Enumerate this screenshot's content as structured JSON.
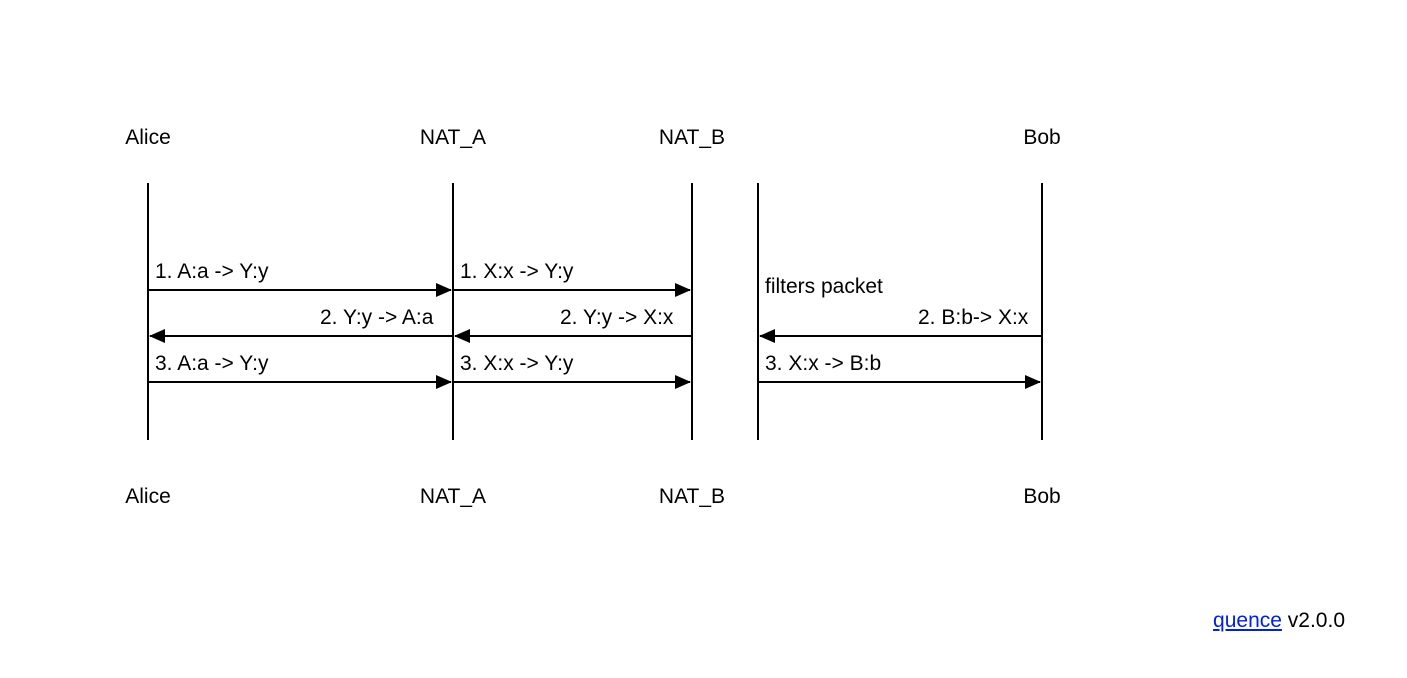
{
  "actors": {
    "alice": "Alice",
    "nat_a": "NAT_A",
    "nat_b": "NAT_B",
    "bob": "Bob"
  },
  "messages": {
    "r1_ab": "1. A:a -> Y:y",
    "r1_bc": "1. X:x -> Y:y",
    "r1_note": "filters packet",
    "r2_ab": "2. Y:y -> A:a",
    "r2_bc": "2. Y:y -> X:x",
    "r2_cd": "2. B:b-> X:x",
    "r3_ab": "3. A:a -> Y:y",
    "r3_bc": "3. X:x -> Y:y",
    "r3_cd": "3. X:x -> B:b"
  },
  "credit": {
    "link_text": "quence",
    "version": " v2.0.0"
  }
}
